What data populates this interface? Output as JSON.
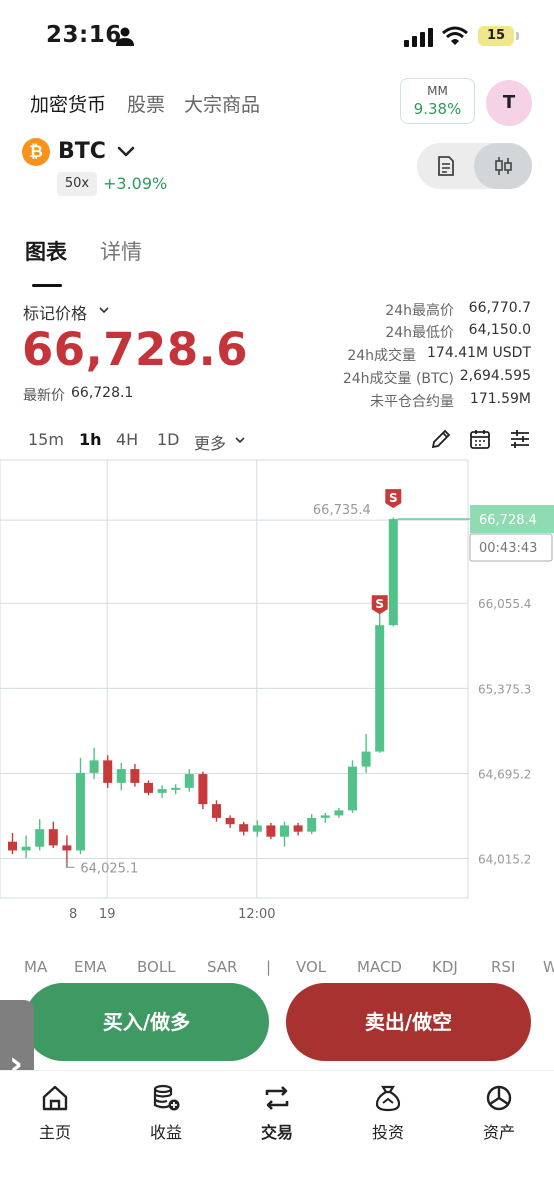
{
  "status_bar": {
    "time": "23:16",
    "battery": "15"
  },
  "market_tabs": [
    "加密货币",
    "股票",
    "大宗商品"
  ],
  "mm": {
    "label": "MM",
    "value": "9.38%"
  },
  "avatar_letter": "T",
  "symbol": {
    "logo": "₿",
    "name": "BTC",
    "leverage": "50x",
    "change": "+3.09%"
  },
  "chart_tabs": [
    "图表",
    "详情"
  ],
  "price": {
    "mark_label": "标记价格",
    "mark_price": "66,728.6",
    "last_label": "最新价",
    "last_value": "66,728.1"
  },
  "stats": [
    {
      "label": "24h最高价",
      "value": "66,770.7"
    },
    {
      "label": "24h最低价",
      "value": "64,150.0"
    },
    {
      "label": "24h成交量",
      "value": "174.41M USDT"
    },
    {
      "label": "24h成交量 (BTC)",
      "value": "2,694.595"
    },
    {
      "label": "未平仓合约量",
      "value": "171.59M"
    }
  ],
  "intervals": [
    "15m",
    "1h",
    "4H",
    "1D",
    "更多"
  ],
  "chart_data": {
    "type": "candlestick",
    "interval": "1h",
    "y_ticks": [
      66055.4,
      65375.3,
      64695.2,
      64015.2
    ],
    "y_range": [
      63700,
      67200
    ],
    "x_ticks": [
      {
        "label": "8",
        "index": 4.5
      },
      {
        "label": "19",
        "index": 7
      },
      {
        "label": "12:00",
        "index": 18
      }
    ],
    "annotations": {
      "high": {
        "label": "66,735.4",
        "value": 66735.4,
        "index": 28
      },
      "low": {
        "label": "64,025.1",
        "value": 64025.1,
        "index": 4
      }
    },
    "current_price": {
      "label": "66,728.4",
      "value": 66728.4,
      "countdown": "00:43:43"
    },
    "sell_markers": [
      {
        "index": 27,
        "text": "S"
      },
      {
        "index": 28,
        "text": "S"
      }
    ],
    "candles": [
      {
        "o": 64150,
        "h": 64220,
        "l": 64050,
        "c": 64080
      },
      {
        "o": 64080,
        "h": 64200,
        "l": 64020,
        "c": 64110
      },
      {
        "o": 64110,
        "h": 64330,
        "l": 64080,
        "c": 64250
      },
      {
        "o": 64250,
        "h": 64310,
        "l": 64100,
        "c": 64120
      },
      {
        "o": 64120,
        "h": 64200,
        "l": 63950,
        "c": 64080
      },
      {
        "o": 64080,
        "h": 64820,
        "l": 64050,
        "c": 64700
      },
      {
        "o": 64700,
        "h": 64900,
        "l": 64650,
        "c": 64800
      },
      {
        "o": 64800,
        "h": 64840,
        "l": 64580,
        "c": 64620
      },
      {
        "o": 64620,
        "h": 64780,
        "l": 64560,
        "c": 64730
      },
      {
        "o": 64730,
        "h": 64770,
        "l": 64590,
        "c": 64620
      },
      {
        "o": 64620,
        "h": 64640,
        "l": 64520,
        "c": 64540
      },
      {
        "o": 64540,
        "h": 64600,
        "l": 64500,
        "c": 64570
      },
      {
        "o": 64570,
        "h": 64610,
        "l": 64530,
        "c": 64580
      },
      {
        "o": 64580,
        "h": 64730,
        "l": 64550,
        "c": 64690
      },
      {
        "o": 64690,
        "h": 64710,
        "l": 64410,
        "c": 64450
      },
      {
        "o": 64450,
        "h": 64480,
        "l": 64310,
        "c": 64340
      },
      {
        "o": 64340,
        "h": 64360,
        "l": 64260,
        "c": 64290
      },
      {
        "o": 64290,
        "h": 64310,
        "l": 64200,
        "c": 64230
      },
      {
        "o": 64230,
        "h": 64320,
        "l": 64190,
        "c": 64280
      },
      {
        "o": 64280,
        "h": 64300,
        "l": 64170,
        "c": 64190
      },
      {
        "o": 64190,
        "h": 64310,
        "l": 64110,
        "c": 64280
      },
      {
        "o": 64280,
        "h": 64300,
        "l": 64200,
        "c": 64230
      },
      {
        "o": 64230,
        "h": 64370,
        "l": 64210,
        "c": 64340
      },
      {
        "o": 64340,
        "h": 64380,
        "l": 64300,
        "c": 64360
      },
      {
        "o": 64360,
        "h": 64420,
        "l": 64340,
        "c": 64400
      },
      {
        "o": 64400,
        "h": 64800,
        "l": 64380,
        "c": 64750
      },
      {
        "o": 64750,
        "h": 65010,
        "l": 64700,
        "c": 64870
      },
      {
        "o": 64870,
        "h": 65990,
        "l": 64860,
        "c": 65880
      },
      {
        "o": 65880,
        "h": 66740,
        "l": 65870,
        "c": 66728
      }
    ]
  },
  "indicators": [
    "MA",
    "EMA",
    "BOLL",
    "SAR",
    "|",
    "VOL",
    "MACD",
    "KDJ",
    "RSI",
    "W"
  ],
  "buttons": {
    "buy": "买入/做多",
    "sell": "卖出/做空"
  },
  "nav": [
    "主页",
    "收益",
    "交易",
    "投资",
    "资产"
  ]
}
